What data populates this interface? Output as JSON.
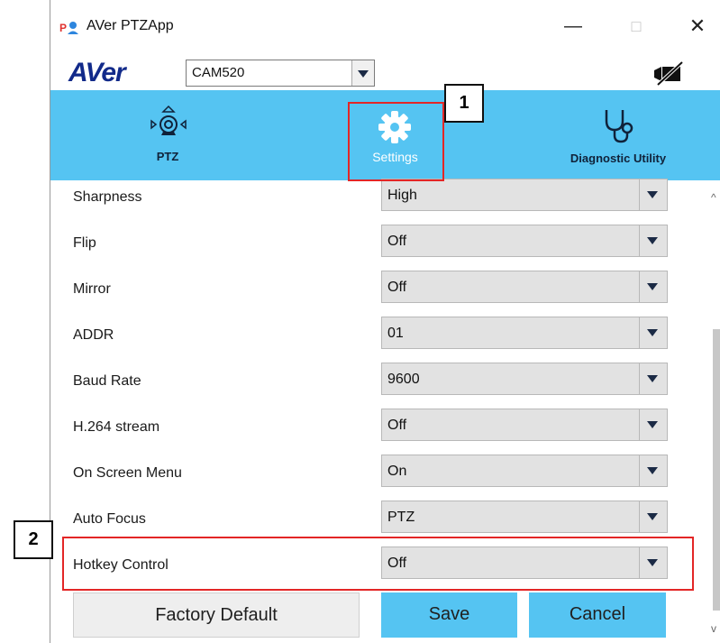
{
  "window": {
    "title": "AVer PTZApp",
    "minimize": "—",
    "maximize": "□",
    "close": "✕"
  },
  "header": {
    "logo": "AVer",
    "camera_select": "CAM520",
    "camera_icon": "camera-off-icon"
  },
  "nav": {
    "items": [
      {
        "label": "PTZ",
        "icon": "ptz-camera-icon"
      },
      {
        "label": "Settings",
        "icon": "gear-icon"
      },
      {
        "label": "Diagnostic Utility",
        "icon": "stethoscope-icon"
      }
    ],
    "selected": "Settings"
  },
  "settings": {
    "rows": [
      {
        "label": "Sharpness",
        "value": "High"
      },
      {
        "label": "Flip",
        "value": "Off"
      },
      {
        "label": "Mirror",
        "value": "Off"
      },
      {
        "label": "ADDR",
        "value": "01"
      },
      {
        "label": "Baud Rate",
        "value": "9600"
      },
      {
        "label": "H.264 stream",
        "value": "Off"
      },
      {
        "label": "On Screen Menu",
        "value": "On"
      },
      {
        "label": "Auto Focus",
        "value": "PTZ"
      },
      {
        "label": "Hotkey Control",
        "value": "Off"
      }
    ]
  },
  "buttons": {
    "factory_default": "Factory Default",
    "save": "Save",
    "cancel": "Cancel"
  },
  "callouts": {
    "first": "1",
    "second": "2"
  },
  "colors": {
    "accent": "#55c4f2",
    "highlight": "#e32626",
    "logo": "#122a8a"
  }
}
